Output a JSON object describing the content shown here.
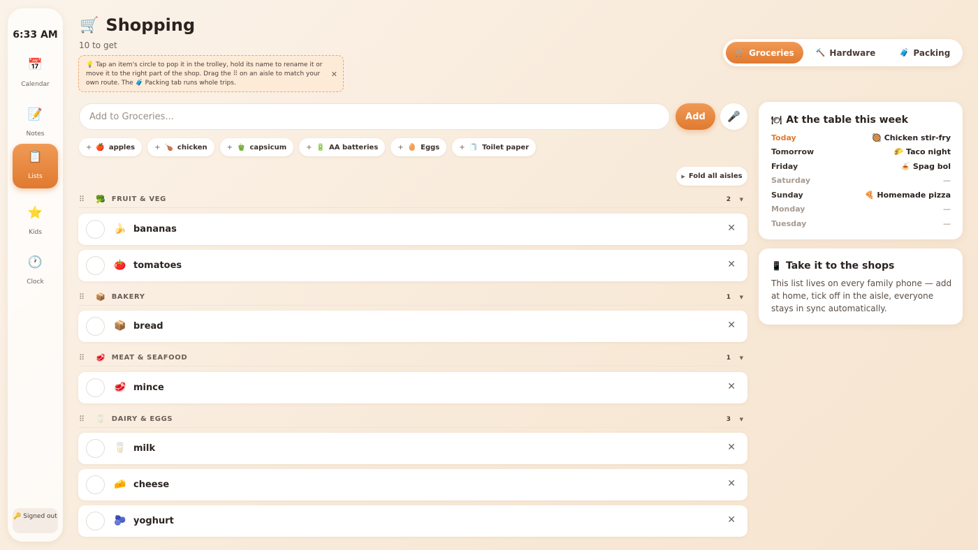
{
  "sidebar": {
    "time": "6:33 AM",
    "items": [
      {
        "label": "Calendar",
        "icon": "calendar-icon",
        "glyph": "📅"
      },
      {
        "label": "Notes",
        "icon": "notes-icon",
        "glyph": "📝"
      },
      {
        "label": "Lists",
        "icon": "clipboard-icon",
        "glyph": "📋"
      },
      {
        "label": "Kids",
        "icon": "star-icon",
        "glyph": "⭐"
      },
      {
        "label": "Clock",
        "icon": "clock-icon",
        "glyph": "🕐"
      }
    ],
    "active_item": "Lists",
    "signed_out": "🔑 Signed out"
  },
  "header": {
    "title": "Shopping",
    "cart_glyph": "🛒",
    "subtitle": "10 to get",
    "hint": "💡 Tap an item's circle to pop it in the trolley, hold its name to rename it or move it to the right part of the shop. Drag the ⠿ on an aisle to match your own route. The 🧳 Packing tab runs whole trips."
  },
  "tabs": [
    {
      "label": "Groceries",
      "glyph": "🛒",
      "active": true
    },
    {
      "label": "Hardware",
      "glyph": "🔨",
      "active": false
    },
    {
      "label": "Packing",
      "glyph": "🧳",
      "active": false
    }
  ],
  "add": {
    "placeholder": "Add to Groceries...",
    "button_label": "Add",
    "mic_glyph": "🎤"
  },
  "suggestions": [
    {
      "label": "apples",
      "glyph": "🍎"
    },
    {
      "label": "chicken",
      "glyph": "🍗"
    },
    {
      "label": "capsicum",
      "glyph": "🫑"
    },
    {
      "label": "AA batteries",
      "glyph": "🔋"
    },
    {
      "label": "Eggs",
      "glyph": "🥚"
    },
    {
      "label": "Toilet paper",
      "glyph": "🧻"
    }
  ],
  "fold_label": "Fold all aisles",
  "aisles": [
    {
      "name": "FRUIT & VEG",
      "glyph": "🥦",
      "count": "2",
      "items": [
        {
          "name": "bananas",
          "glyph": "🍌"
        },
        {
          "name": "tomatoes",
          "glyph": "🍅"
        }
      ]
    },
    {
      "name": "BAKERY",
      "glyph": "📦",
      "count": "1",
      "items": [
        {
          "name": "bread",
          "glyph": "📦"
        }
      ]
    },
    {
      "name": "MEAT & SEAFOOD",
      "glyph": "🥩",
      "count": "1",
      "items": [
        {
          "name": "mince",
          "glyph": "🥩"
        }
      ]
    },
    {
      "name": "DAIRY & EGGS",
      "glyph": "🥛",
      "count": "3",
      "items": [
        {
          "name": "milk",
          "glyph": "🥛"
        },
        {
          "name": "cheese",
          "glyph": "🧀"
        },
        {
          "name": "yoghurt",
          "glyph": "🫐"
        }
      ]
    }
  ],
  "week": {
    "title": "At the table this week",
    "title_glyph": "🍽",
    "days": [
      {
        "day": "Today",
        "meal": "🥘 Chicken stir-fry",
        "state": "today"
      },
      {
        "day": "Tomorrow",
        "meal": "🌮 Taco night",
        "state": "normal"
      },
      {
        "day": "Friday",
        "meal": "🍝 Spag bol",
        "state": "normal"
      },
      {
        "day": "Saturday",
        "meal": "—",
        "state": "empty"
      },
      {
        "day": "Sunday",
        "meal": "🍕 Homemade pizza",
        "state": "normal"
      },
      {
        "day": "Monday",
        "meal": "—",
        "state": "empty"
      },
      {
        "day": "Tuesday",
        "meal": "—",
        "state": "empty"
      }
    ]
  },
  "shops": {
    "title": "Take it to the shops",
    "title_glyph": "📱",
    "text": "This list lives on every family phone — add at home, tick off in the aisle, everyone stays in sync automatically."
  },
  "colors": {
    "accent": "#e07a30",
    "background": "#f8ead9"
  }
}
